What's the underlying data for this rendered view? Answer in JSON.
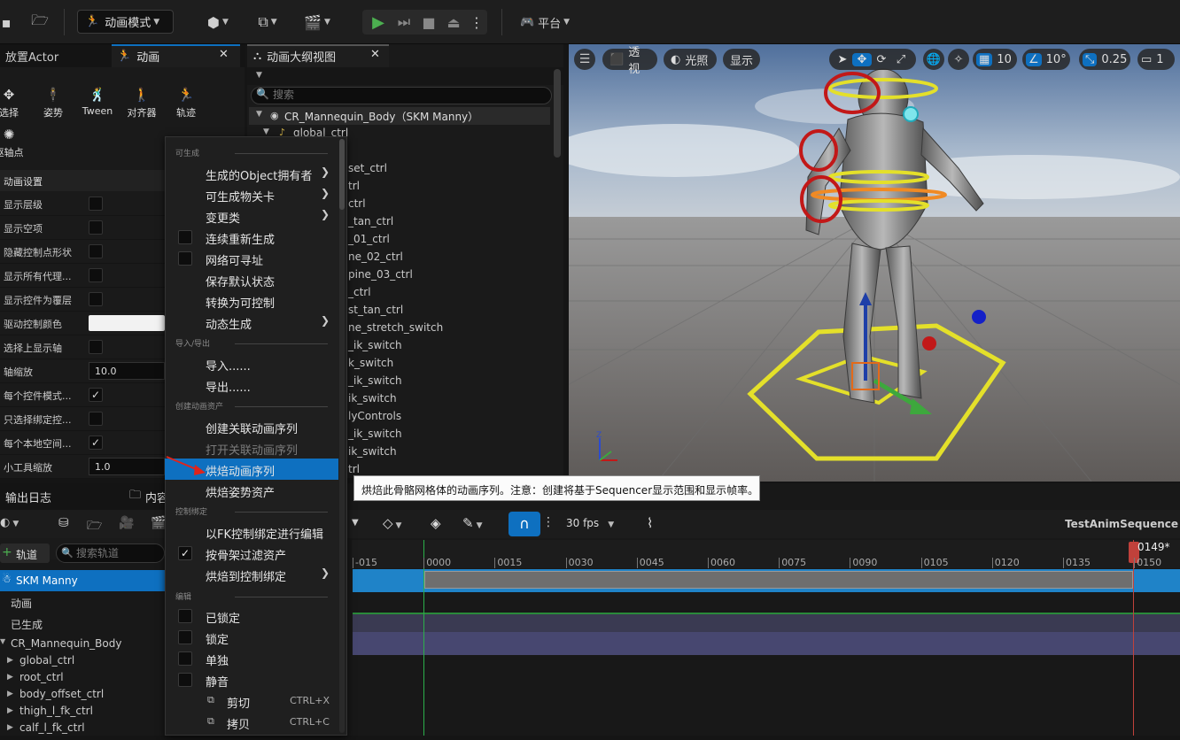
{
  "toolbar": {
    "mode_label": "动画模式",
    "platform_label": "平台"
  },
  "tabs": {
    "place_actor": "放置Actor",
    "animation": "动画",
    "anim_outliner": "动画大纲视图"
  },
  "tools": [
    "选择",
    "姿势",
    "Tween",
    "对齐器",
    "轨迹"
  ],
  "pivot_tool": "驱轴点",
  "anim_settings": {
    "header": "动画设置",
    "rows": [
      {
        "label": "显示层级",
        "type": "checkbox",
        "checked": false
      },
      {
        "label": "显示空项",
        "type": "checkbox",
        "checked": false
      },
      {
        "label": "隐藏控制点形状",
        "type": "checkbox",
        "checked": false
      },
      {
        "label": "显示所有代理...",
        "type": "checkbox",
        "checked": false
      },
      {
        "label": "显示控件为覆层",
        "type": "checkbox",
        "checked": false
      },
      {
        "label": "驱动控制颜色",
        "type": "color",
        "value": ""
      },
      {
        "label": "选择上显示轴",
        "type": "checkbox",
        "checked": false
      },
      {
        "label": "轴缩放",
        "type": "number",
        "value": "10.0"
      },
      {
        "label": "每个控件模式...",
        "type": "checkbox",
        "checked": true
      },
      {
        "label": "只选择绑定控...",
        "type": "checkbox",
        "checked": false
      },
      {
        "label": "每个本地空间...",
        "type": "checkbox",
        "checked": true
      },
      {
        "label": "小工具缩放",
        "type": "number",
        "value": "1.0"
      }
    ]
  },
  "outliner": {
    "search_placeholder": "搜索",
    "root": "CR_Mannequin_Body（SKM Manny）",
    "first_child": "global_ctrl",
    "partial_items": [
      "set_ctrl",
      "trl",
      "ctrl",
      "_tan_ctrl",
      "_01_ctrl",
      "ne_02_ctrl",
      "pine_03_ctrl",
      "_ctrl",
      "st_tan_ctrl",
      "ne_stretch_switch",
      "_ik_switch",
      "k_switch",
      "_ik_switch",
      "ik_switch",
      "lyControls",
      "_ik_switch",
      "ik_switch",
      "trl"
    ]
  },
  "viewport": {
    "perspective": "透视",
    "lit": "光照",
    "show": "显示",
    "grid_size": "10",
    "rot_snap": "10°",
    "scale_snap": "0.25",
    "camera_speed": "1"
  },
  "lower": {
    "output_log_tab": "输出日志",
    "content_tab": "内容",
    "add_track": "轨道",
    "search_tracks_placeholder": "搜索轨道",
    "fps": "30 fps",
    "sequence_name": "TestAnimSequence",
    "current_frame": "0149*",
    "ticks": [
      "-015",
      "0000",
      "0015",
      "0030",
      "0045",
      "0060",
      "0075",
      "0090",
      "0105",
      "0120",
      "0135",
      "0150"
    ],
    "tracks": [
      "SKM Manny",
      "动画",
      "已生成",
      "CR_Mannequin_Body",
      "global_ctrl",
      "root_ctrl",
      "body_offset_ctrl",
      "thigh_l_fk_ctrl",
      "calf_l_fk_ctrl"
    ]
  },
  "context_menu": {
    "sections": [
      "可生成",
      "导入/导出",
      "创建动画资产",
      "控制绑定",
      "编辑"
    ],
    "items": [
      {
        "label": "生成的Object拥有者",
        "sub": true
      },
      {
        "label": "可生成物关卡",
        "sub": true
      },
      {
        "label": "变更类",
        "sub": true
      },
      {
        "label": "连续重新生成",
        "checkbox": true,
        "checked": false
      },
      {
        "label": "网络可寻址",
        "checkbox": true,
        "checked": false
      },
      {
        "label": "保存默认状态"
      },
      {
        "label": "转换为可控制"
      },
      {
        "label": "动态生成",
        "sub": true
      },
      {
        "label": "导入......"
      },
      {
        "label": "导出......"
      },
      {
        "label": "创建关联动画序列"
      },
      {
        "label": "打开关联动画序列",
        "disabled": true
      },
      {
        "label": "烘焙动画序列",
        "highlighted": true
      },
      {
        "label": "烘焙姿势资产"
      },
      {
        "label": "以FK控制绑定进行编辑"
      },
      {
        "label": "按骨架过滤资产",
        "checkbox": true,
        "checked": true
      },
      {
        "label": "烘焙到控制绑定",
        "sub": true
      },
      {
        "label": "已锁定",
        "checkbox": true,
        "checked": false
      },
      {
        "label": "锁定",
        "checkbox": true,
        "checked": false
      },
      {
        "label": "单独",
        "checkbox": true,
        "checked": false
      },
      {
        "label": "静音",
        "checkbox": true,
        "checked": false
      },
      {
        "label": "剪切",
        "shortcut": "CTRL+X"
      },
      {
        "label": "拷贝",
        "shortcut": "CTRL+C"
      }
    ]
  },
  "tooltip": "烘焙此骨骼网格体的动画序列。注意：创建将基于Sequencer显示范围和显示帧率。",
  "colors": {
    "accent": "#0e70c0",
    "play": "#4caf50",
    "timeline_bar": "#1f83c8"
  }
}
